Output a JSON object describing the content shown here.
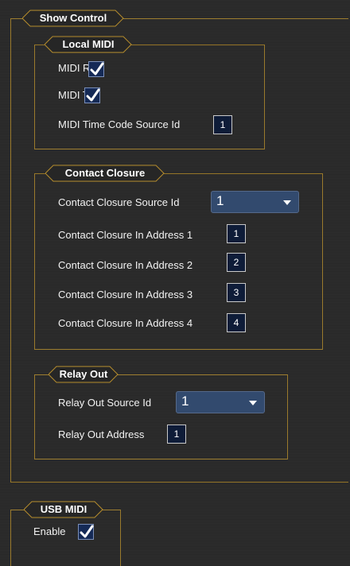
{
  "show_control": {
    "title": "Show Control",
    "local_midi": {
      "title": "Local MIDI",
      "midi_rx_label": "MIDI Rx",
      "midi_rx_checked": true,
      "midi_tx_label": "MIDI Tx",
      "midi_tx_checked": true,
      "mtc_source_label": "MIDI Time Code Source Id",
      "mtc_source_value": "1"
    },
    "contact_closure": {
      "title": "Contact Closure",
      "source_id_label": "Contact Closure Source Id",
      "source_id_value": "1",
      "inputs": [
        {
          "label": "Contact Closure In Address 1",
          "value": "1"
        },
        {
          "label": "Contact Closure In Address 2",
          "value": "2"
        },
        {
          "label": "Contact Closure In Address 3",
          "value": "3"
        },
        {
          "label": "Contact Closure In Address 4",
          "value": "4"
        }
      ]
    },
    "relay_out": {
      "title": "Relay Out",
      "source_id_label": "Relay Out Source Id",
      "source_id_value": "1",
      "address_label": "Relay Out Address",
      "address_value": "1"
    }
  },
  "usb_midi": {
    "title": "USB MIDI",
    "enable_label": "Enable",
    "enable_checked": true
  },
  "icons": {
    "checkbox_check": "checkmark-icon",
    "dropdown_caret": "chevron-down-icon"
  },
  "colors": {
    "border_gold": "#9a7a2c",
    "field_bg": "#0e1c38",
    "dropdown_bg": "#324a6e"
  }
}
